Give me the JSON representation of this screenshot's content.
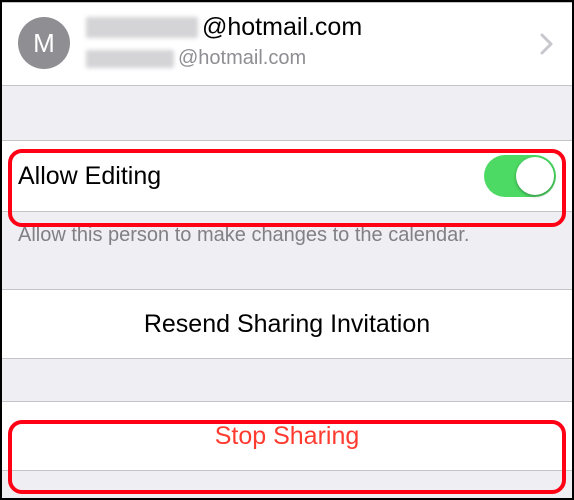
{
  "account": {
    "avatar_initial": "M",
    "primary_suffix": "@hotmail.com",
    "secondary_suffix": "@hotmail.com"
  },
  "allow_editing": {
    "label": "Allow Editing",
    "enabled": true,
    "footer": "Allow this person to make changes to the calendar."
  },
  "resend": {
    "label": "Resend Sharing Invitation"
  },
  "stop": {
    "label": "Stop Sharing"
  }
}
